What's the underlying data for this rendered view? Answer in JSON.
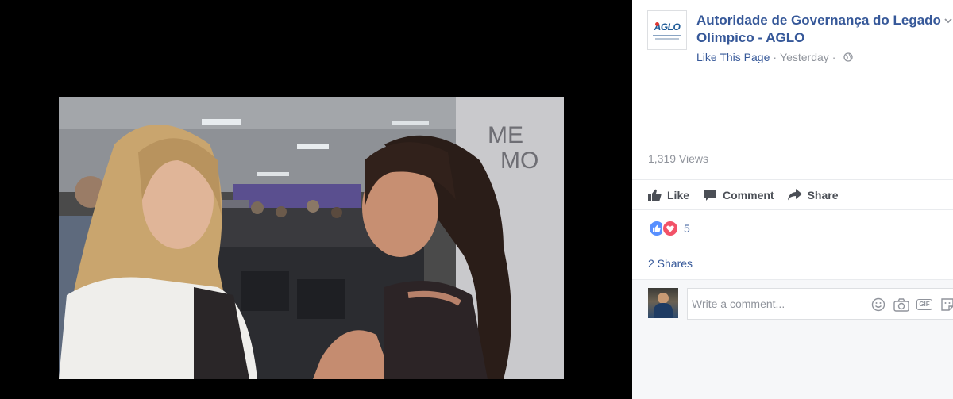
{
  "post": {
    "page_name": "Autoridade de Governança do Legado Olímpico - AGLO",
    "like_page": "Like This Page",
    "separator": "·",
    "time": "Yesterday",
    "logo_text": "AGLO"
  },
  "stats": {
    "views": "1,319 Views",
    "reaction_count": "5",
    "shares": "2 Shares"
  },
  "actions": {
    "like": "Like",
    "comment": "Comment",
    "share": "Share"
  },
  "comment": {
    "placeholder": "Write a comment..."
  },
  "icons": {
    "globe": "globe-icon",
    "caret": "chevron-down-icon",
    "like": "thumbs-up-icon",
    "comment": "speech-bubble-icon",
    "share": "share-arrow-icon",
    "emoji": "emoji-icon",
    "camera": "camera-icon",
    "gif": "gif-icon",
    "sticker": "sticker-icon"
  },
  "colors": {
    "link": "#365899",
    "meta": "#90949c",
    "like_reaction": "#5890ff",
    "love_reaction": "#f25268",
    "player_background": "#000000"
  }
}
